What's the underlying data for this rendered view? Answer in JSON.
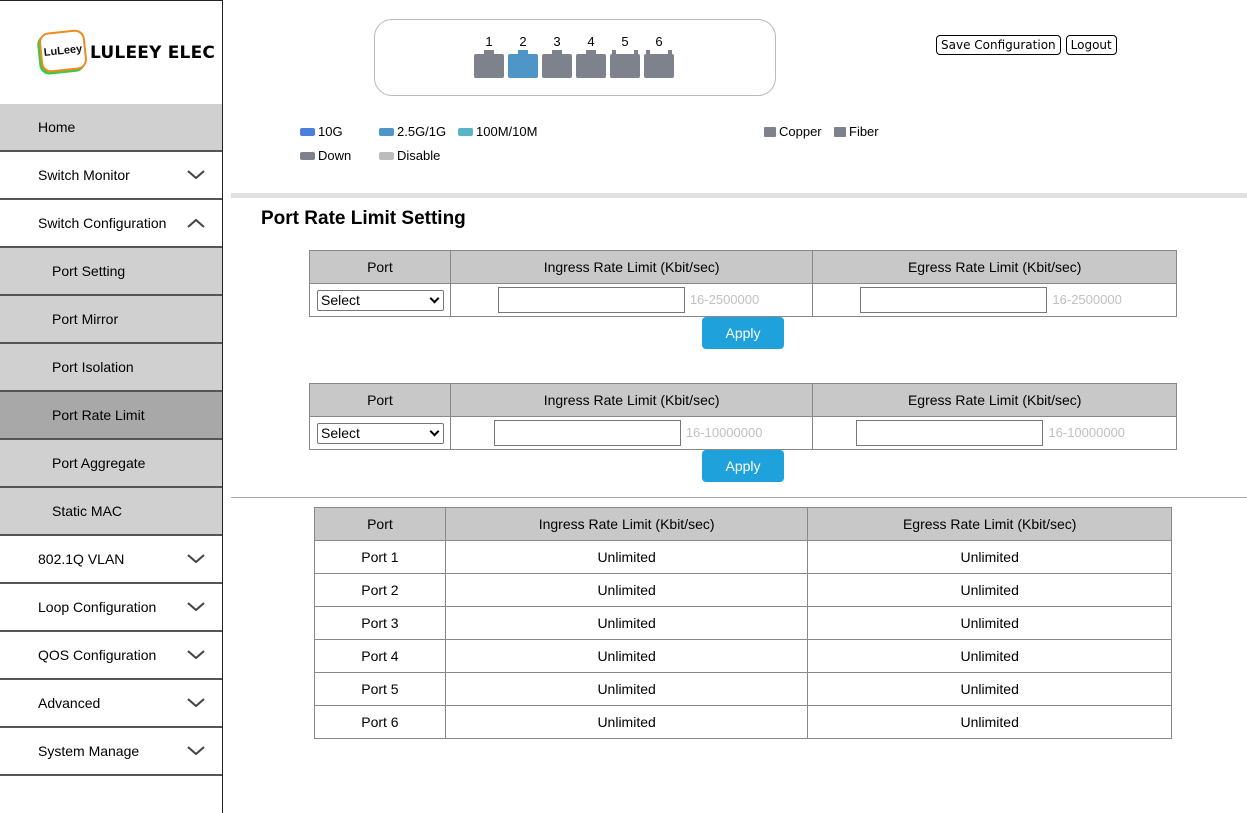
{
  "logo": {
    "badge_text": "LuLeey",
    "brand": "LULEEY ELEC"
  },
  "sidebar": {
    "items": [
      {
        "label": "Home"
      },
      {
        "label": "Switch Monitor"
      },
      {
        "label": "Switch Configuration"
      },
      {
        "label": "Port Setting"
      },
      {
        "label": "Port Mirror"
      },
      {
        "label": "Port Isolation"
      },
      {
        "label": "Port Rate Limit"
      },
      {
        "label": "Port Aggregate"
      },
      {
        "label": "Static MAC"
      },
      {
        "label": "802.1Q VLAN"
      },
      {
        "label": "Loop Configuration"
      },
      {
        "label": "QOS Configuration"
      },
      {
        "label": "Advanced"
      },
      {
        "label": "System Manage"
      }
    ]
  },
  "ports": [
    {
      "num": "1",
      "status": "down",
      "media": "copper"
    },
    {
      "num": "2",
      "status": "2.5G/1G",
      "media": "copper"
    },
    {
      "num": "3",
      "status": "down",
      "media": "copper"
    },
    {
      "num": "4",
      "status": "down",
      "media": "copper"
    },
    {
      "num": "5",
      "status": "down",
      "media": "fiber"
    },
    {
      "num": "6",
      "status": "down",
      "media": "fiber"
    }
  ],
  "header": {
    "save_label": "Save Configuration",
    "logout_label": "Logout"
  },
  "legend": {
    "speed_10g": "10G",
    "speed_25g": "2.5G/1G",
    "speed_100m": "100M/10M",
    "down": "Down",
    "disable": "Disable",
    "copper": "Copper",
    "fiber": "Fiber",
    "colors": {
      "10g": "#4a7fdc",
      "25g": "#4e96c8",
      "100m": "#5ab4c8",
      "down": "#7d828c",
      "disable": "#bcbcbc"
    }
  },
  "page_title": "Port Rate Limit Setting",
  "form1": {
    "col_port": "Port",
    "col_ingress": "Ingress Rate Limit (Kbit/sec)",
    "col_egress": "Egress Rate Limit (Kbit/sec)",
    "select_value": "Select",
    "ingress_value": "",
    "egress_value": "",
    "ingress_hint": "16-2500000",
    "egress_hint": "16-2500000",
    "apply": "Apply"
  },
  "form2": {
    "col_port": "Port",
    "col_ingress": "Ingress Rate Limit (Kbit/sec)",
    "col_egress": "Egress Rate Limit (Kbit/sec)",
    "select_value": "Select",
    "ingress_value": "",
    "egress_value": "",
    "ingress_hint": "16-10000000",
    "egress_hint": "16-10000000",
    "apply": "Apply"
  },
  "status_table": {
    "headers": [
      "Port",
      "Ingress Rate Limit (Kbit/sec)",
      "Egress Rate Limit (Kbit/sec)"
    ],
    "rows": [
      [
        "Port 1",
        "Unlimited",
        "Unlimited"
      ],
      [
        "Port 2",
        "Unlimited",
        "Unlimited"
      ],
      [
        "Port 3",
        "Unlimited",
        "Unlimited"
      ],
      [
        "Port 4",
        "Unlimited",
        "Unlimited"
      ],
      [
        "Port 5",
        "Unlimited",
        "Unlimited"
      ],
      [
        "Port 6",
        "Unlimited",
        "Unlimited"
      ]
    ]
  }
}
